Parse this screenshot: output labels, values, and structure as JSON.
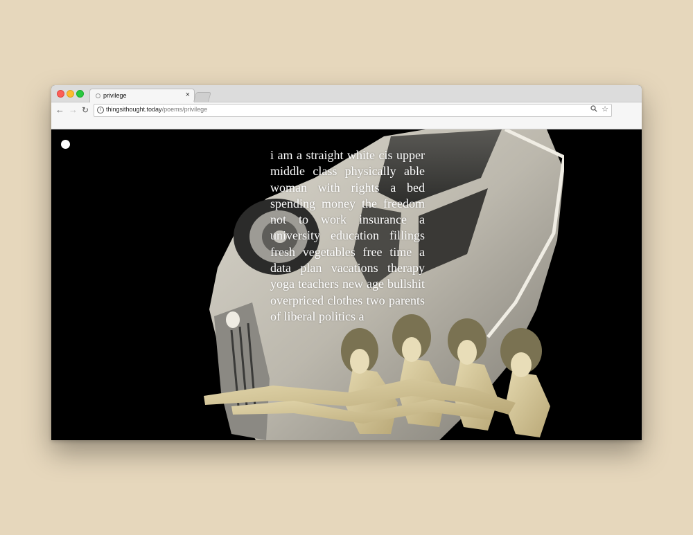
{
  "browser": {
    "tab_title": "privilege",
    "tab_close": "×",
    "url_host": "thingsithought.today",
    "url_path": "/poems/privilege",
    "icons": {
      "back": "arrow-left-icon",
      "forward": "arrow-right-icon",
      "reload": "reload-icon",
      "info": "info-icon",
      "search": "search-icon",
      "bookmark": "star-icon"
    }
  },
  "page": {
    "poem_text": "i am a straight white cis upper middle class physically able woman with rights a bed spending money the freedom not to work insurance a university education fillings fresh vegetables free time a data plan vacations therapy yoga teachers new age bullshit overpriced clothes two parents of liberal politics a"
  },
  "colors": {
    "background": "#e6d7bc",
    "page_background": "#000000",
    "text": "#ffffff"
  }
}
